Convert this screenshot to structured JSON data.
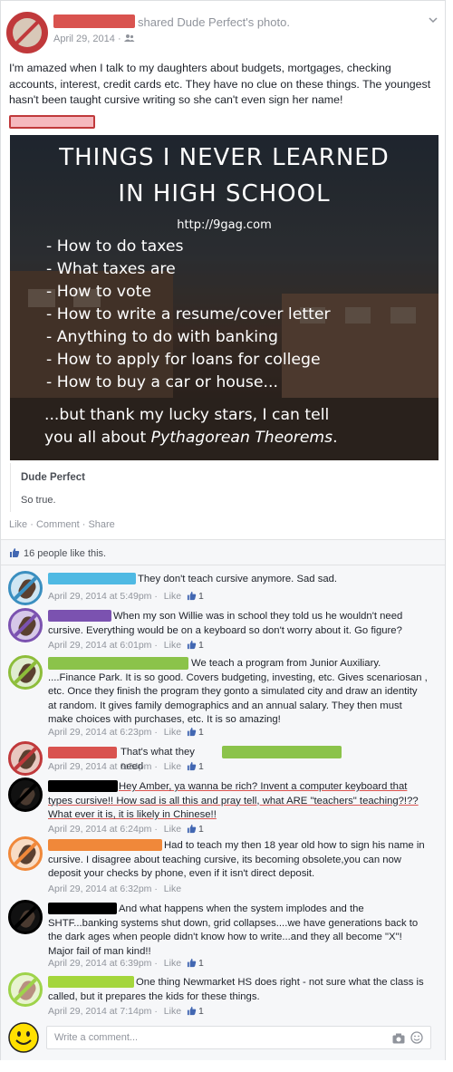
{
  "post": {
    "shared_text": "shared Dude Perfect's photo.",
    "date": "April 29, 2014",
    "audience_icon": "friends-icon",
    "body": "I'm amazed when I talk to my daughters about budgets, mortgages, checking accounts, interest, credit cards etc. They have no clue on these things. The youngest hasn't been taught cursive writing so she can't even sign her name!",
    "options_icon": "chevron-down-icon"
  },
  "meme": {
    "title_line1": "THINGS I NEVER LEARNED",
    "title_line2": "IN HIGH SCHOOL",
    "url": "http://9gag.com",
    "items": [
      "- How to do taxes",
      "- What taxes are",
      "- How to vote",
      "- How to write a resume/cover letter",
      "- Anything to do with banking",
      "- How to apply for loans for college",
      "- How to buy a car or house..."
    ],
    "footer_line1": "...but thank my lucky stars, I can tell",
    "footer_line2_prefix": "you all about ",
    "footer_line2_em": "Pythagorean Theorems",
    "footer_line2_suffix": "."
  },
  "source": {
    "name": "Dude Perfect",
    "description": "So true."
  },
  "actions": {
    "like": "Like",
    "sep1": " · ",
    "comment": "Comment",
    "sep2": " · ",
    "share": "Share"
  },
  "likes": {
    "text": "16 people like this."
  },
  "comments": [
    {
      "text": "They don't teach cursive anymore. Sad sad.",
      "time": "April 29, 2014 at 5:49pm",
      "like": "Like",
      "count": "1",
      "avatar_color": "#3a8fc0"
    },
    {
      "text": "When my son Willie was in school they told us he wouldn't need cursive. Everything would be on a keyboard so don't worry about it. Go figure?",
      "time": "April 29, 2014 at 6:01pm",
      "like": "Like",
      "count": "1",
      "avatar_color": "#7b52b0"
    },
    {
      "text": "We teach a program from Junior Auxiliary. ....Finance Park. It is so good. Covers budgeting, investing, etc. Gives scenariosan , etc. Once they finish the program they gonto a simulated city and draw an identity at random. It gives family demographics and an annual salary. They then must make choices with purchases, etc. It is so amazing!",
      "time": "April 29, 2014 at 6:23pm",
      "like": "Like",
      "count": "1",
      "avatar_color": "#8dbd3a"
    },
    {
      "text": "That's what they need",
      "time": "April 29, 2014 at 6:24pm",
      "like": "Like",
      "count": "1",
      "avatar_color": "#c0393b"
    },
    {
      "text": "Hey Amber, ya wanna be rich? Invent a computer keyboard that types cursive!! How sad is all this and pray tell, what ARE \"teachers\" teaching?!?? What ever it is, it is likely in Chinese!!",
      "time": "April 29, 2014 at 6:24pm",
      "like": "Like",
      "count": "1",
      "avatar_color": "#000000"
    },
    {
      "text": "Had to teach my then 18 year old how to sign his name in cursive. I disagree about teaching cursive, its becoming obsolete,you can now deposit your checks by phone, even if it isn't direct deposit.",
      "time": "April 29, 2014 at 6:32pm",
      "like": "Like",
      "count": "",
      "avatar_color": "#f0883a"
    },
    {
      "text": "And what happens when the system implodes and the SHTF...banking systems shut down, grid collapses....we have generations back to the dark ages when people didn't know how to write...and they all become \"X\"! Major fail of man kind!!",
      "time": "April 29, 2014 at 6:39pm",
      "like": "Like",
      "count": "1",
      "avatar_color": "#000000"
    },
    {
      "text": "One thing Newmarket HS does right - not sure what the class is called, but it prepares the kids for these things.",
      "time": "April 29, 2014 at 7:14pm",
      "like": "Like",
      "count": "1",
      "avatar_color": "#9ed34a"
    }
  ],
  "write_comment": {
    "placeholder": "Write a comment...",
    "camera_icon": "camera-icon",
    "emoji_icon": "emoji-icon"
  },
  "colors": {
    "redact_red": "#d9534f",
    "redact_cyan": "#4fb9e3",
    "redact_purple": "#7b52b0",
    "redact_green": "#8bc34a",
    "redact_black": "#000000",
    "redact_orange": "#f0883a",
    "redact_lime": "#a4d63c",
    "smiley_yellow": "#ffe000"
  }
}
